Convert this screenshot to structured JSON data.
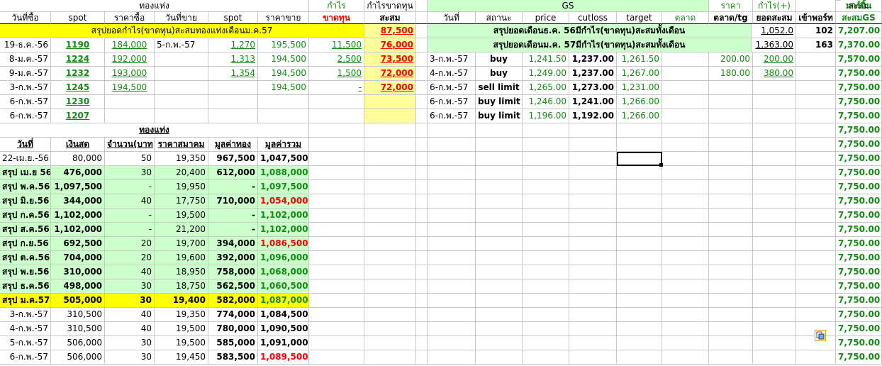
{
  "header": {
    "group_tonghaeng": "ทองแห่ง",
    "profit_label": "กำไร",
    "profit_loss_label": "กำไรขาดทุน",
    "gs_label": "GS",
    "price_label": "ราคา",
    "profit_plus_label": "กำไร(+)",
    "accum_label": "สะสม",
    "margin_label": "มาร์จิ้น",
    "row2": [
      "วันที่ซื้อ",
      "spot",
      "ราคาซื้อ",
      "วันที่ขาย",
      "spot",
      "ราคาขาย",
      "ขาดทุน",
      "สะสม"
    ],
    "row2_right": [
      "วันที่",
      "สถานะ",
      "price",
      "cutloss",
      "target",
      "ตลาด",
      "ตลาด/tg",
      "ยอดสะสม",
      "เข้าพอร์ท",
      "สะสมGS"
    ]
  },
  "summary_left": {
    "label": "สรุปยอดกำไร(ขาดทุน)สะสมทองแท่งเดือนม.ค.57",
    "value": "87,500"
  },
  "trades": [
    {
      "buy_date": "19-ธ.ค.-56",
      "spot": "1190",
      "buy_price": "184,000",
      "sell_date": "5-ก.พ.-57",
      "sell_spot": "1,270",
      "sell_price": "195,500",
      "profit": "11,500",
      "accum": "76,000"
    },
    {
      "buy_date": "8-ม.ค.-57",
      "spot": "1224",
      "buy_price": "192,000",
      "sell_date": "",
      "sell_spot": "1,313",
      "sell_price": "194,500",
      "profit": "2,500",
      "accum": "73,500"
    },
    {
      "buy_date": "9-ม.ค.-57",
      "spot": "1232",
      "buy_price": "193,000",
      "sell_date": "",
      "sell_spot": "1,354",
      "sell_price": "194,500",
      "profit": "1,500",
      "accum": "72,000"
    },
    {
      "buy_date": "3-ก.พ.-57",
      "spot": "1245",
      "buy_price": "194,500",
      "sell_date": "",
      "sell_spot": "",
      "sell_price": "194,500",
      "profit": "-",
      "accum": "72,000"
    },
    {
      "buy_date": "6-ก.พ.-57",
      "spot": "1230",
      "buy_price": "",
      "sell_date": "",
      "sell_spot": "",
      "sell_price": "",
      "profit": "",
      "accum": ""
    },
    {
      "buy_date": "6-ก.พ.-57",
      "spot": "1207",
      "buy_price": "",
      "sell_date": "",
      "sell_spot": "",
      "sell_price": "",
      "profit": "",
      "accum": ""
    }
  ],
  "holdings_header": {
    "title": "ทองแท่ง",
    "cols": [
      "วันที่",
      "เงินสด",
      "จำนวน(บาท",
      "ราคาสมาคม",
      "มูลค่าทอง",
      "มูลค่ารวม"
    ]
  },
  "holdings": [
    {
      "date": "22-เม.ย.-56",
      "cash": "80,000",
      "qty": "50",
      "price": "19,350",
      "gold": "967,500",
      "total": "1,047,500",
      "style": "plain"
    },
    {
      "date": "สรุป เม.ย 56",
      "cash": "476,000",
      "qty": "30",
      "price": "20,400",
      "gold": "612,000",
      "total": "1,088,000",
      "style": "sum"
    },
    {
      "date": "สรุป พ.ค.56",
      "cash": "1,097,500",
      "qty": "-",
      "price": "19,950",
      "gold": "-",
      "total": "1,097,500",
      "style": "sum"
    },
    {
      "date": "สรุป มิ.ย.56",
      "cash": "344,000",
      "qty": "40",
      "price": "17,750",
      "gold": "710,000",
      "total": "1,054,000",
      "style": "sum-red"
    },
    {
      "date": "สรุป ก.ค.56",
      "cash": "1,102,000",
      "qty": "-",
      "price": "19,500",
      "gold": "-",
      "total": "1,102,000",
      "style": "sum"
    },
    {
      "date": "สรุป ส.ค.56",
      "cash": "1,102,000",
      "qty": "-",
      "price": "21,200",
      "gold": "-",
      "total": "1,102,000",
      "style": "sum"
    },
    {
      "date": "สรุป ก.ย.56",
      "cash": "692,500",
      "qty": "20",
      "price": "19,700",
      "gold": "394,000",
      "total": "1,086,500",
      "style": "sum-red"
    },
    {
      "date": "สรุป ต.ค.56",
      "cash": "704,000",
      "qty": "20",
      "price": "19,600",
      "gold": "392,000",
      "total": "1,096,000",
      "style": "sum"
    },
    {
      "date": "สรุป พ.ย.56",
      "cash": "310,000",
      "qty": "40",
      "price": "18,950",
      "gold": "758,000",
      "total": "1,068,000",
      "style": "sum"
    },
    {
      "date": "สรุป ธ.ค.56",
      "cash": "498,000",
      "qty": "30",
      "price": "18,750",
      "gold": "562,500",
      "total": "1,060,500",
      "style": "sum"
    },
    {
      "date": "สรุป ม.ค.57",
      "cash": "505,000",
      "qty": "30",
      "price": "19,400",
      "gold": "582,000",
      "total": "1,087,000",
      "style": "yellow"
    },
    {
      "date": "3-ก.พ.-57",
      "cash": "310,500",
      "qty": "40",
      "price": "19,350",
      "gold": "774,000",
      "total": "1,084,500",
      "style": "plain"
    },
    {
      "date": "4-ก.พ.-57",
      "cash": "310,500",
      "qty": "40",
      "price": "19,500",
      "gold": "780,000",
      "total": "1,090,500",
      "style": "plain"
    },
    {
      "date": "5-ก.พ.-57",
      "cash": "506,000",
      "qty": "30",
      "price": "19,500",
      "gold": "585,000",
      "total": "1,091,000",
      "style": "plain"
    },
    {
      "date": "6-ก.พ.-57",
      "cash": "506,000",
      "qty": "30",
      "price": "19,450",
      "gold": "583,500",
      "total": "1,089,500",
      "style": "plain-red"
    }
  ],
  "gs_summaries": [
    {
      "label": "สรุปยอดเดือนธ.ค. 56มีกำไร(ขาดทุน)สะสมทั้งเดือน",
      "accum": "1,052.0",
      "port": "102",
      "gs": "7,207.00"
    },
    {
      "label": "สรุปยอดเดือนม.ค. 57มีกำไร(ขาดทุน)สะสมทั้งเดือน",
      "accum": "1,363.00",
      "port": "163",
      "gs": "7,370.00"
    }
  ],
  "gs_trades": [
    {
      "date": "3-ก.พ.-57",
      "status": "buy",
      "price": "1,241.50",
      "cutloss": "1,237.00",
      "target": "1,261.50",
      "market": "",
      "tg": "200.00",
      "accum": "200.00",
      "gs": "7,570.00"
    },
    {
      "date": "4-ก.พ.-57",
      "status": "buy",
      "price": "1,249.00",
      "cutloss": "1,237.00",
      "target": "1,267.00",
      "market": "",
      "tg": "180.00",
      "accum": "380.00",
      "gs": "7,750.00"
    },
    {
      "date": "6-ก.พ.-57",
      "status": "sell limit",
      "price": "1,265.00",
      "cutloss": "1,273.00",
      "target": "1,231.00",
      "market": "",
      "tg": "",
      "accum": "",
      "gs": "7,750.00"
    },
    {
      "date": "6-ก.พ.-57",
      "status": "buy limit",
      "price": "1,246.00",
      "cutloss": "1,241.00",
      "target": "1,266.00",
      "market": "",
      "tg": "",
      "accum": "",
      "gs": "7,750.00"
    },
    {
      "date": "6-ก.พ.-57",
      "status": "buy limit",
      "price": "1,196.00",
      "cutloss": "1,192.00",
      "target": "1,266.00",
      "market": "",
      "tg": "",
      "accum": "",
      "gs": "7,750.00"
    }
  ],
  "gs_tail": [
    "7,750.00",
    "7,750.00",
    "7,750.00",
    "7,750.00",
    "7,750.00",
    "7,750.00",
    "7,750.00",
    "7,750.00",
    "7,750.00",
    "7,750.00",
    "7,750.00",
    "7,750.00",
    "7,750.00",
    "7,750.00",
    "7,750.00",
    "7,750.00",
    "7,750.00"
  ],
  "colors": {
    "green": "#138a13",
    "red": "#ff0000",
    "light_green": "#ccffcc",
    "yellow": "#ffff00",
    "light_yellow": "#ffff99"
  }
}
